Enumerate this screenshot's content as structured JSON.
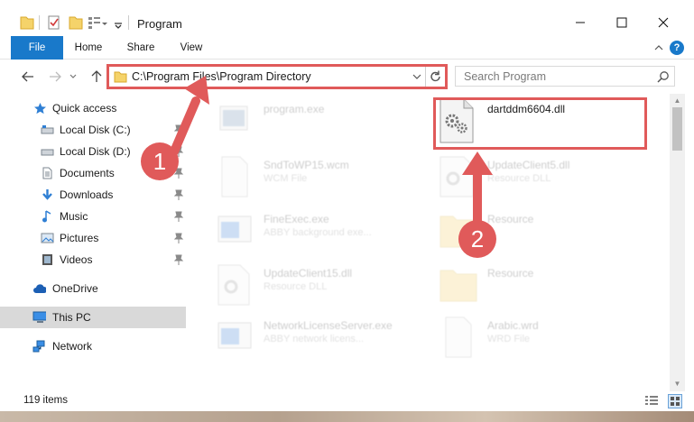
{
  "window": {
    "title": "Program",
    "minimize_icon": "minimize-icon",
    "maximize_icon": "maximize-icon",
    "close_icon": "close-icon"
  },
  "ribbon": {
    "tabs": [
      {
        "label": "File"
      },
      {
        "label": "Home"
      },
      {
        "label": "Share"
      },
      {
        "label": "View"
      }
    ]
  },
  "address": {
    "path": "C:\\Program Files\\Program Directory",
    "search_placeholder": "Search Program"
  },
  "nav": {
    "items": [
      {
        "label": "Quick access"
      },
      {
        "label": "Local Disk (C:)"
      },
      {
        "label": "Local Disk (D:)"
      },
      {
        "label": "Documents"
      },
      {
        "label": "Downloads"
      },
      {
        "label": "Music"
      },
      {
        "label": "Pictures"
      },
      {
        "label": "Videos"
      },
      {
        "label": "OneDrive"
      },
      {
        "label": "This PC"
      },
      {
        "label": "Network"
      }
    ]
  },
  "files": {
    "items": [
      {
        "name": "program.exe",
        "desc": ""
      },
      {
        "name": "dartddm6604.dll",
        "desc": ""
      },
      {
        "name": "SndToWP15.wcm",
        "desc": "WCM File"
      },
      {
        "name": "UpdateClient5.dll",
        "desc": "Resource DLL"
      },
      {
        "name": "FineExec.exe",
        "desc": "ABBY background exe..."
      },
      {
        "name": "Resource",
        "desc": ""
      },
      {
        "name": "UpdateClient15.dll",
        "desc": "Resource DLL"
      },
      {
        "name": "Resource",
        "desc": ""
      },
      {
        "name": "NetworkLicenseServer.exe",
        "desc": "ABBY network licens..."
      },
      {
        "name": "Arabic.wrd",
        "desc": "WRD File"
      }
    ]
  },
  "status": {
    "item_count": "119 items"
  },
  "annotations": {
    "step1": "1",
    "step2": "2",
    "color": "#e05a5a"
  },
  "colors": {
    "file_tab": "#1979ca",
    "selection": "#d9d9d9"
  }
}
